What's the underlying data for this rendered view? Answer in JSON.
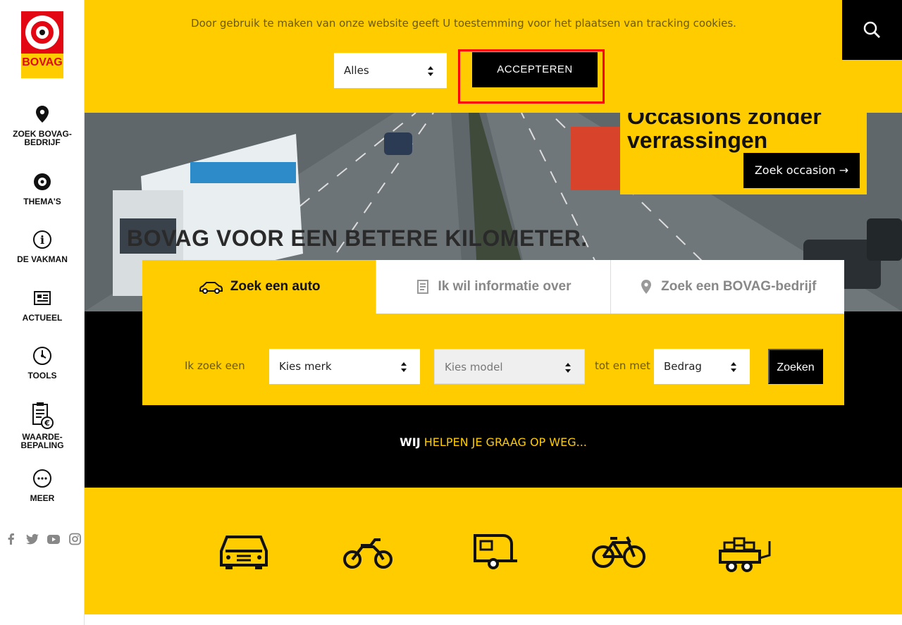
{
  "logo": {
    "text": "BOVAG"
  },
  "sidebar": {
    "items": [
      {
        "label": "ZOEK BOVAG-BEDRIJF",
        "icon": "location-pin-icon"
      },
      {
        "label": "THEMA'S",
        "icon": "themes-icon"
      },
      {
        "label": "DE VAKMAN",
        "icon": "info-icon"
      },
      {
        "label": "ACTUEEL",
        "icon": "newspaper-icon"
      },
      {
        "label": "TOOLS",
        "icon": "gauge-icon"
      },
      {
        "label": "WAARDE-BEPALING",
        "icon": "valuation-icon"
      },
      {
        "label": "MEER",
        "icon": "more-icon"
      }
    ],
    "social": [
      "facebook-icon",
      "twitter-icon",
      "youtube-icon",
      "instagram-icon"
    ]
  },
  "cookie": {
    "message": "Door gebruik te maken van onze website geeft U toestemming voor het plaatsen van tracking cookies.",
    "select_value": "Alles",
    "accept_label": "ACCEPTEREN"
  },
  "hero": {
    "tagline": "BOVAG VOOR EEN BETERE KILOMETER.",
    "promo_title_line1": "Occasions zonder",
    "promo_title_line2": "verrassingen",
    "promo_button": "Zoek occasion"
  },
  "search": {
    "tabs": [
      {
        "label": "Zoek een auto",
        "icon": "car-icon"
      },
      {
        "label": "Ik wil informatie over",
        "icon": "document-icon"
      },
      {
        "label": "Zoek een BOVAG-bedrijf",
        "icon": "location-pin-icon"
      }
    ],
    "lead": "Ik zoek een",
    "brand_value": "Kies merk",
    "model_value": "Kies model",
    "tot_en_met": "tot en met",
    "amount_value": "Bedrag",
    "submit": "Zoeken"
  },
  "help": {
    "bold": "WIJ",
    "rest": " HELPEN JE GRAAG OP WEG..."
  },
  "categories": [
    "car-icon",
    "motorcycle-icon",
    "caravan-icon",
    "bicycle-icon",
    "trailer-icon"
  ],
  "colors": {
    "brand_yellow": "#ffcc00",
    "brand_red": "#e30613",
    "black": "#000000"
  }
}
